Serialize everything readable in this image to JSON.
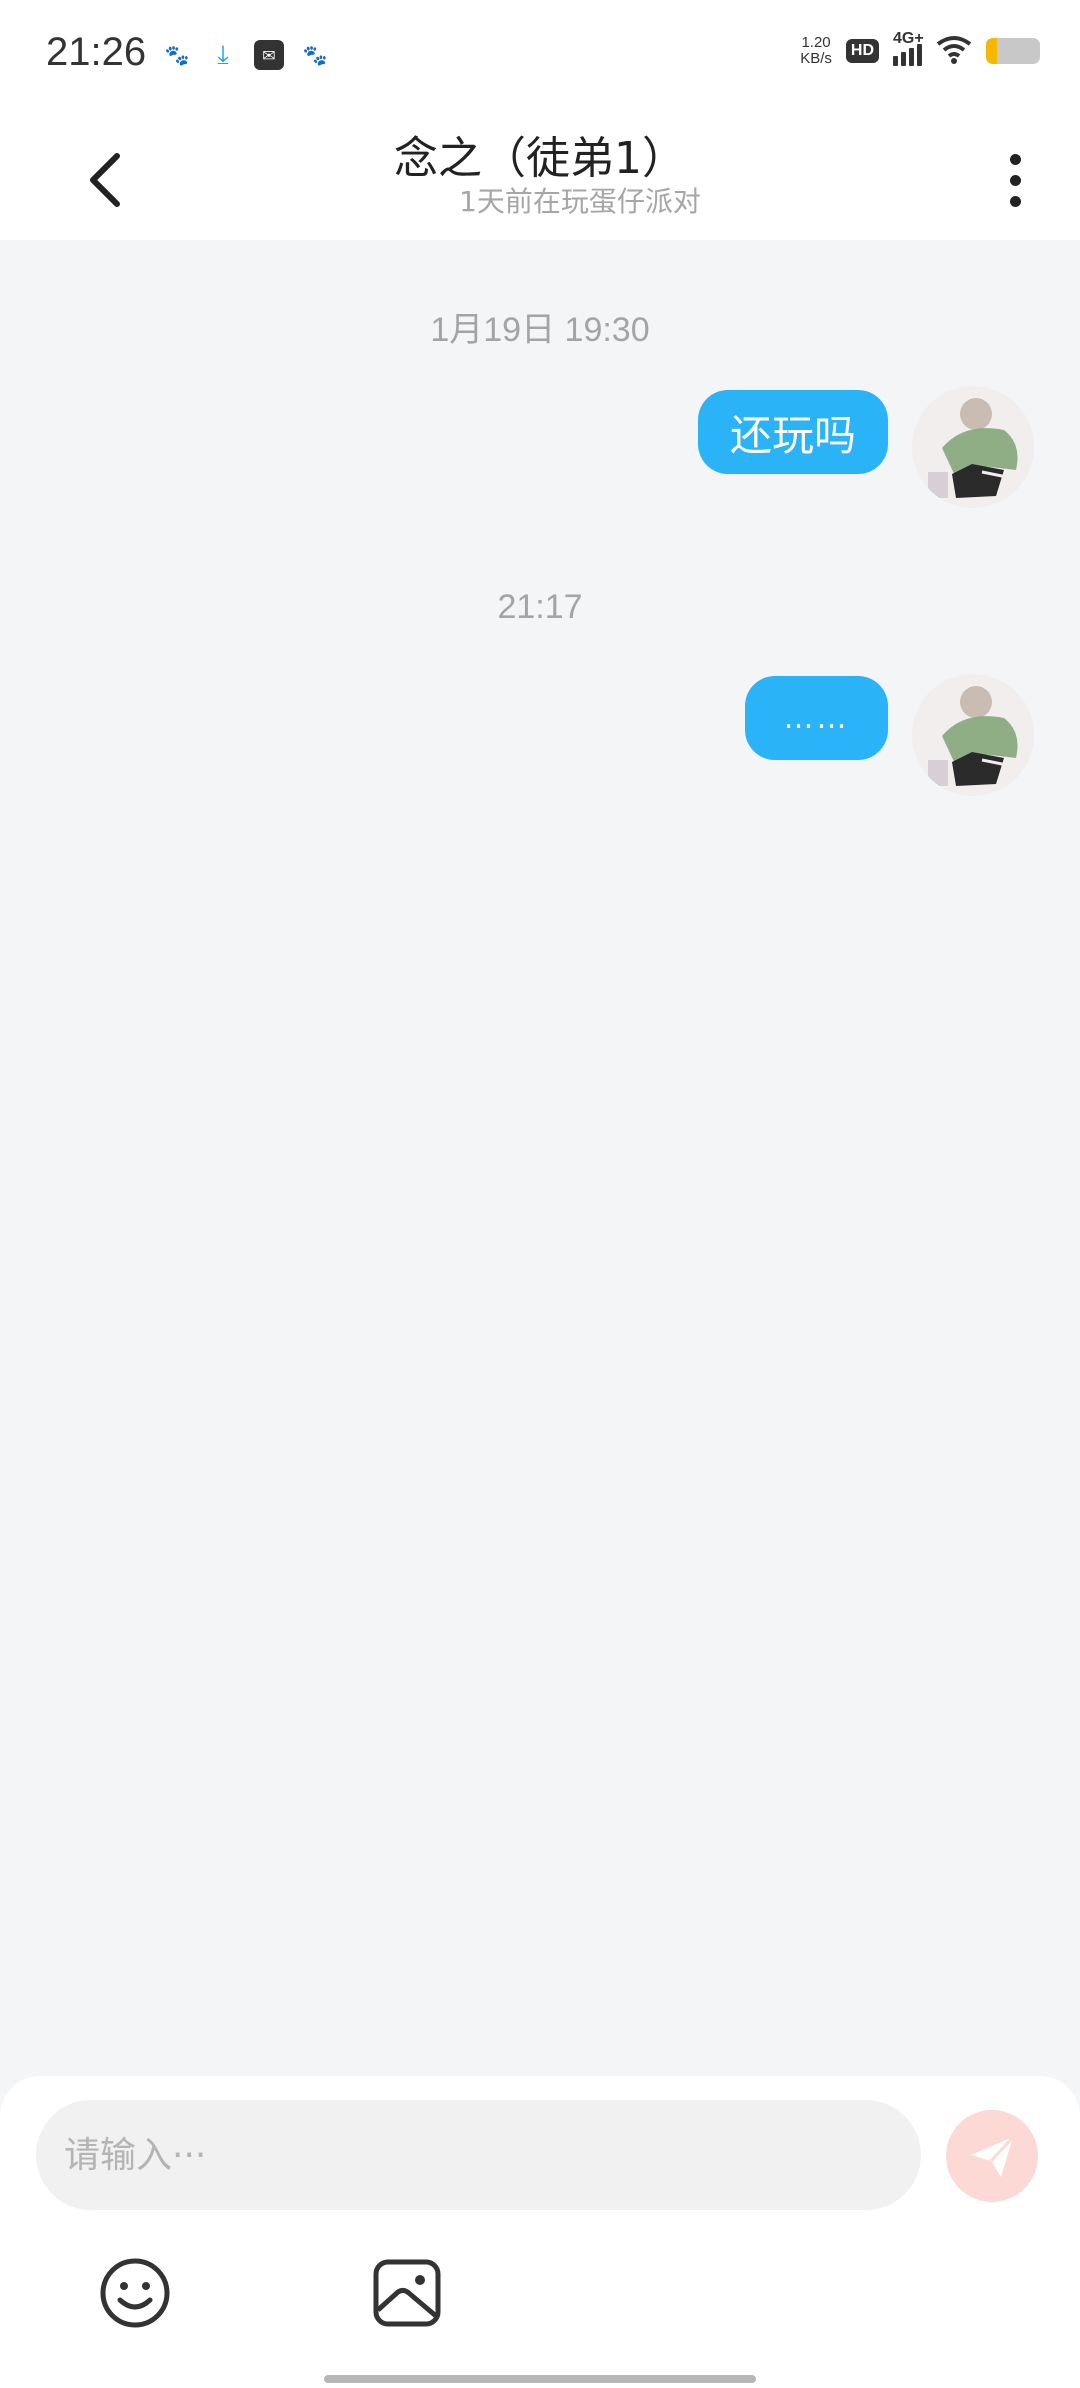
{
  "status_bar": {
    "time": "21:26",
    "app_icons": [
      "baidu-paw-icon",
      "download-icon",
      "mail-app-icon",
      "baidu-app-icon"
    ],
    "net_speed_value": "1.20",
    "net_speed_unit": "KB/s",
    "hd_label": "HD",
    "signal_label": "4G+",
    "signal_level": 4,
    "battery_level": 0.2,
    "battery_color": "#f5b700"
  },
  "header": {
    "title": "念之（徒弟1）",
    "subtitle": "1天前在玩蛋仔派对"
  },
  "messages": [
    {
      "timestamp": "1月19日 19:30",
      "text": "还玩吗",
      "sender": "self"
    },
    {
      "timestamp": "21:17",
      "text": "……",
      "sender": "self"
    }
  ],
  "composer": {
    "placeholder": "请输入···",
    "value": ""
  },
  "colors": {
    "bubble": "#2ab3f6",
    "background": "#f4f5f7",
    "send_button": "#fcd9d5"
  }
}
